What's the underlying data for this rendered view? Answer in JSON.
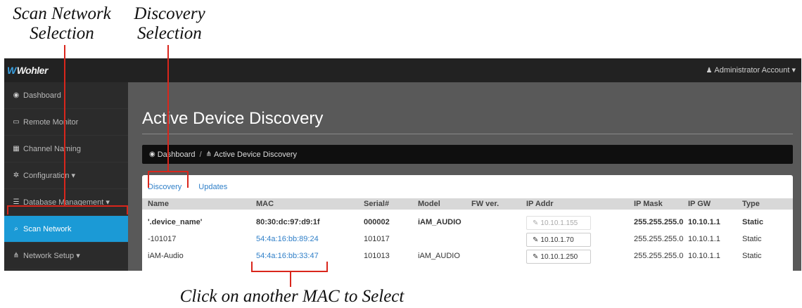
{
  "annotations": {
    "scan_line1": "Scan Network",
    "scan_line2": "Selection",
    "disc_line1": "Discovery",
    "disc_line2": "Selection",
    "mac_caption": "Click on another MAC to Select",
    "highlight_color": "#d9261c"
  },
  "topbar": {
    "logo": "Wohler",
    "account": "Administrator Account",
    "account_icon": "user-icon",
    "caret": "caret-down-icon"
  },
  "sidebar": {
    "items": [
      {
        "label": "Dashboard",
        "icon": "dashboard-icon",
        "glyph": "◉",
        "caret": ""
      },
      {
        "label": "Remote Monitor",
        "icon": "monitor-icon",
        "glyph": "▭",
        "caret": ""
      },
      {
        "label": "Channel Naming",
        "icon": "table-icon",
        "glyph": "▦",
        "caret": ""
      },
      {
        "label": "Configuration",
        "icon": "cogs-icon",
        "glyph": "✲",
        "caret": "▾"
      },
      {
        "label": "Database Management",
        "icon": "database-icon",
        "glyph": "☰",
        "caret": "▾"
      },
      {
        "label": "Scan Network",
        "icon": "search-icon",
        "glyph": "⌕",
        "caret": "",
        "active": true
      },
      {
        "label": "Network Setup",
        "icon": "sitemap-icon",
        "glyph": "⋔",
        "caret": "▾"
      }
    ],
    "active_color": "#1b9ad6"
  },
  "main": {
    "title": "Active Device Discovery",
    "breadcrumb": {
      "home": "Dashboard",
      "separator": "/",
      "current": "Active Device Discovery"
    },
    "tabs": [
      "Discovery",
      "Updates"
    ],
    "columns": [
      "Name",
      "MAC",
      "Serial#",
      "Model",
      "FW ver.",
      "IP Addr",
      "IP Mask",
      "IP GW",
      "Type"
    ],
    "rows": [
      {
        "name": "'.device_name'",
        "mac": "80:30:dc:97:d9:1f",
        "serial": "000002",
        "model": "iAM_AUDIO",
        "fw": "",
        "ip": "10.10.1.155",
        "mask": "255.255.255.0",
        "gw": "10.10.1.1",
        "type": "Static"
      },
      {
        "name": "-101017",
        "mac": "54:4a:16:bb:89:24",
        "serial": "101017",
        "model": "",
        "fw": "",
        "ip": "10.10.1.70",
        "mask": "255.255.255.0",
        "gw": "10.10.1.1",
        "type": "Static"
      },
      {
        "name": "iAM-Audio",
        "mac": "54:4a:16:bb:33:47",
        "serial": "101013",
        "model": "iAM_AUDIO",
        "fw": "",
        "ip": "10.10.1.250",
        "mask": "255.255.255.0",
        "gw": "10.10.1.1",
        "type": "Static"
      }
    ]
  }
}
